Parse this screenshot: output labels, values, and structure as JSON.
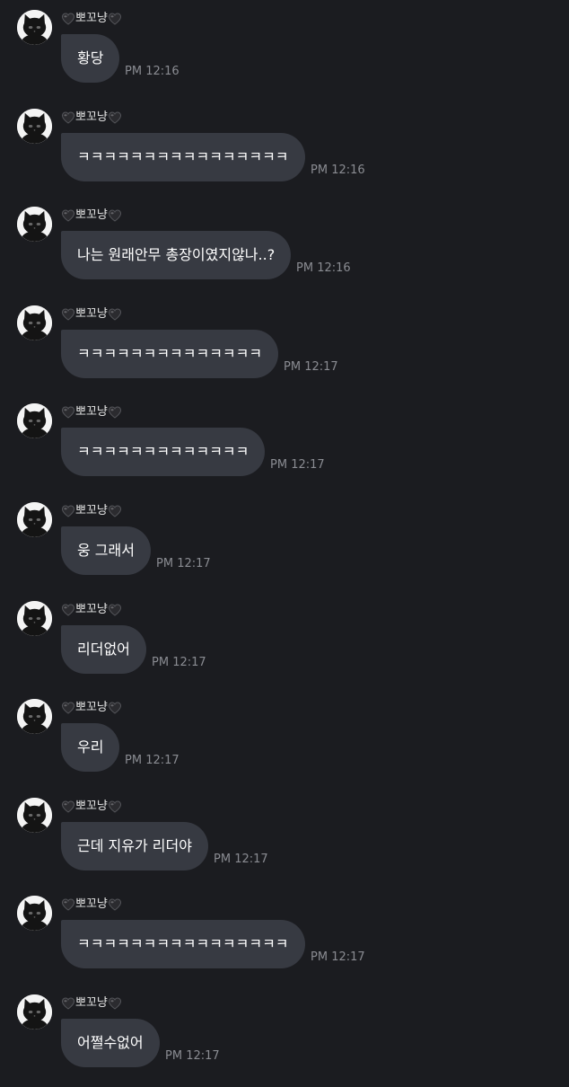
{
  "sender": {
    "name": "뽀꼬냥",
    "decoration_icon": "black-heart-icon",
    "avatar_icon": "black-cat-icon"
  },
  "colors": {
    "background": "#1b1c20",
    "bubble": "#373a42",
    "timestamp": "#8a8c92"
  },
  "messages": [
    {
      "text": "황당",
      "time": "PM 12:16"
    },
    {
      "text": "ㅋㅋㅋㅋㅋㅋㅋㅋㅋㅋㅋㅋㅋㅋㅋㅋ",
      "time": "PM 12:16"
    },
    {
      "text": "나는 원래안무 총장이였지않나..?",
      "time": "PM 12:16"
    },
    {
      "text": "ㅋㅋㅋㅋㅋㅋㅋㅋㅋㅋㅋㅋㅋㅋ",
      "time": "PM 12:17"
    },
    {
      "text": "ㅋㅋㅋㅋㅋㅋㅋㅋㅋㅋㅋㅋㅋ",
      "time": "PM 12:17"
    },
    {
      "text": "웅 그래서",
      "time": "PM 12:17"
    },
    {
      "text": "리더없어",
      "time": "PM 12:17"
    },
    {
      "text": "우리",
      "time": "PM 12:17"
    },
    {
      "text": "근데 지유가 리더야",
      "time": "PM 12:17"
    },
    {
      "text": "ㅋㅋㅋㅋㅋㅋㅋㅋㅋㅋㅋㅋㅋㅋㅋㅋ",
      "time": "PM 12:17"
    },
    {
      "text": "어쩔수없어",
      "time": "PM 12:17"
    }
  ]
}
